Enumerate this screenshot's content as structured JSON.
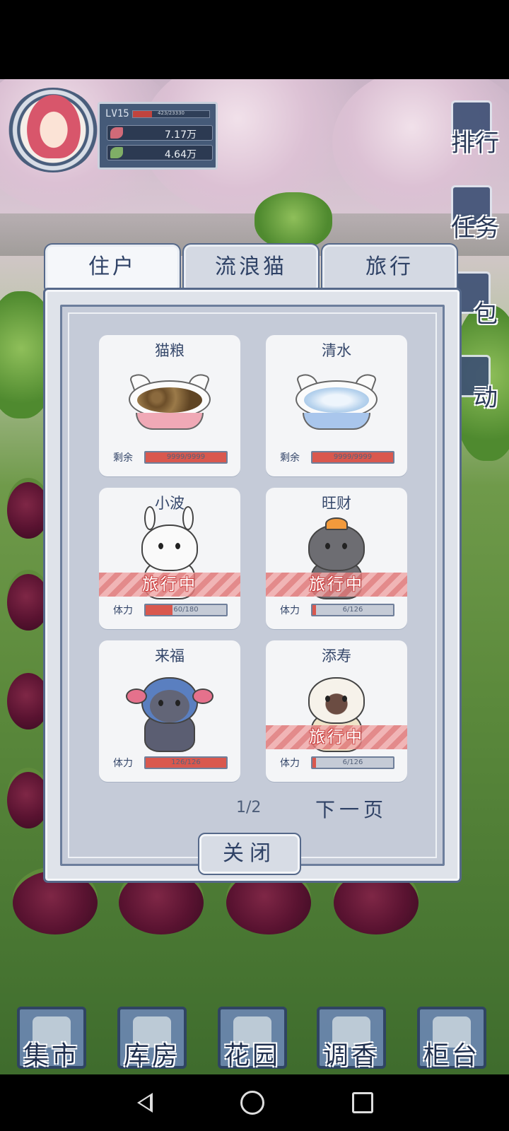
{
  "player": {
    "level": "LV15",
    "exp_text": "423/23330",
    "exp_fraction": 0.25,
    "resource_1": "7.17万",
    "resource_2": "4.64万"
  },
  "side_menu": [
    {
      "label": "排行",
      "icon": "ranking-scroll-icon"
    },
    {
      "label": "任务",
      "icon": "task-scroll-icon"
    },
    {
      "label": "包",
      "icon": "bag-icon"
    },
    {
      "label": "动",
      "icon": "activity-icon"
    }
  ],
  "tabs": [
    {
      "label": "住户",
      "active": true
    },
    {
      "label": "流浪猫",
      "active": false
    },
    {
      "label": "旅行",
      "active": false
    }
  ],
  "cards": {
    "food": {
      "name": "猫粮",
      "stat_label": "剩余",
      "value": "9999/9999",
      "fraction": 1.0
    },
    "water": {
      "name": "清水",
      "stat_label": "剩余",
      "value": "9999/9999",
      "fraction": 1.0
    },
    "xiaobo": {
      "name": "小波",
      "stat_label": "体力",
      "value": "60/180",
      "fraction": 0.333,
      "status": "旅行中"
    },
    "wangcai": {
      "name": "旺财",
      "stat_label": "体力",
      "value": "6/126",
      "fraction": 0.048,
      "status": "旅行中"
    },
    "laifu": {
      "name": "来福",
      "stat_label": "体力",
      "value": "126/126",
      "fraction": 1.0
    },
    "tianshou": {
      "name": "添寿",
      "stat_label": "体力",
      "value": "6/126",
      "fraction": 0.048,
      "status": "旅行中"
    }
  },
  "pager": {
    "text": "1/2",
    "next_label": "下一页"
  },
  "close_label": "关闭",
  "bottom_nav": [
    {
      "label": "集市",
      "icon": "market-gate-icon"
    },
    {
      "label": "库房",
      "icon": "warehouse-icon"
    },
    {
      "label": "花园",
      "icon": "rose-icon"
    },
    {
      "label": "调香",
      "icon": "perfume-icon"
    },
    {
      "label": "柜台",
      "icon": "counter-icon"
    }
  ],
  "colors": {
    "bar_fill": "#d9584e",
    "panel_navy": "#455a78",
    "travel_badge": "#e07878"
  }
}
